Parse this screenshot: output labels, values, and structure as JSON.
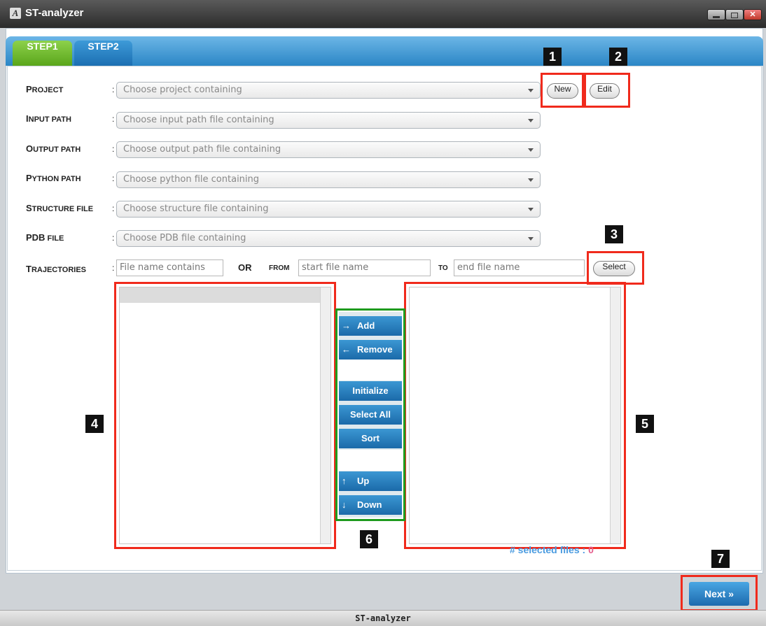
{
  "window": {
    "title": "ST-analyzer",
    "status_title": "ST-analyzer"
  },
  "tabs": [
    {
      "label": "STEP1"
    },
    {
      "label": "STEP2"
    }
  ],
  "form": {
    "project": {
      "label_cap": "P",
      "label_rest": "ROJECT",
      "placeholder": "Choose project containing"
    },
    "input_path": {
      "label_cap": "I",
      "label_rest": "NPUT PATH",
      "placeholder": "Choose input path file containing"
    },
    "output_path": {
      "label_cap": "O",
      "label_rest": "UTPUT PATH",
      "placeholder": "Choose output path file containing"
    },
    "python_path": {
      "label_cap": "P",
      "label_rest": "YTHON PATH",
      "placeholder": "Choose python file containing"
    },
    "structure_file": {
      "label_cap": "S",
      "label_rest": "TRUCTURE FILE",
      "placeholder": "Choose structure file containing"
    },
    "pdb_file": {
      "label_cap": "PDB",
      "label_rest": " FILE",
      "placeholder": "Choose PDB file containing"
    },
    "trajectories": {
      "label_cap": "T",
      "label_rest": "RAJECTORIES",
      "contains_placeholder": "File name contains",
      "or_label": "OR",
      "from_label": "FROM",
      "from_placeholder": "start file name",
      "to_label": "TO",
      "to_placeholder": "end file name"
    },
    "colon": ":"
  },
  "buttons": {
    "new": "New",
    "edit": "Edit",
    "select": "Select",
    "next": "Next »"
  },
  "operations": {
    "add": {
      "icon": "→",
      "label": "Add"
    },
    "remove": {
      "icon": "←",
      "label": "Remove"
    },
    "initialize": "Initialize",
    "select_all": "Select All",
    "sort": "Sort",
    "up": {
      "icon": "↑",
      "label": "Up"
    },
    "down": {
      "icon": "↓",
      "label": "Down"
    }
  },
  "selected_files": {
    "label": "# selected files : ",
    "count": "0"
  },
  "callouts": [
    "1",
    "2",
    "3",
    "4",
    "5",
    "6",
    "7"
  ],
  "colors": {
    "callout_red": "#f02a1c",
    "callout_green": "#1e9b1e",
    "accent_blue": "#1d6aae",
    "step1_green": "#6cb52a"
  }
}
